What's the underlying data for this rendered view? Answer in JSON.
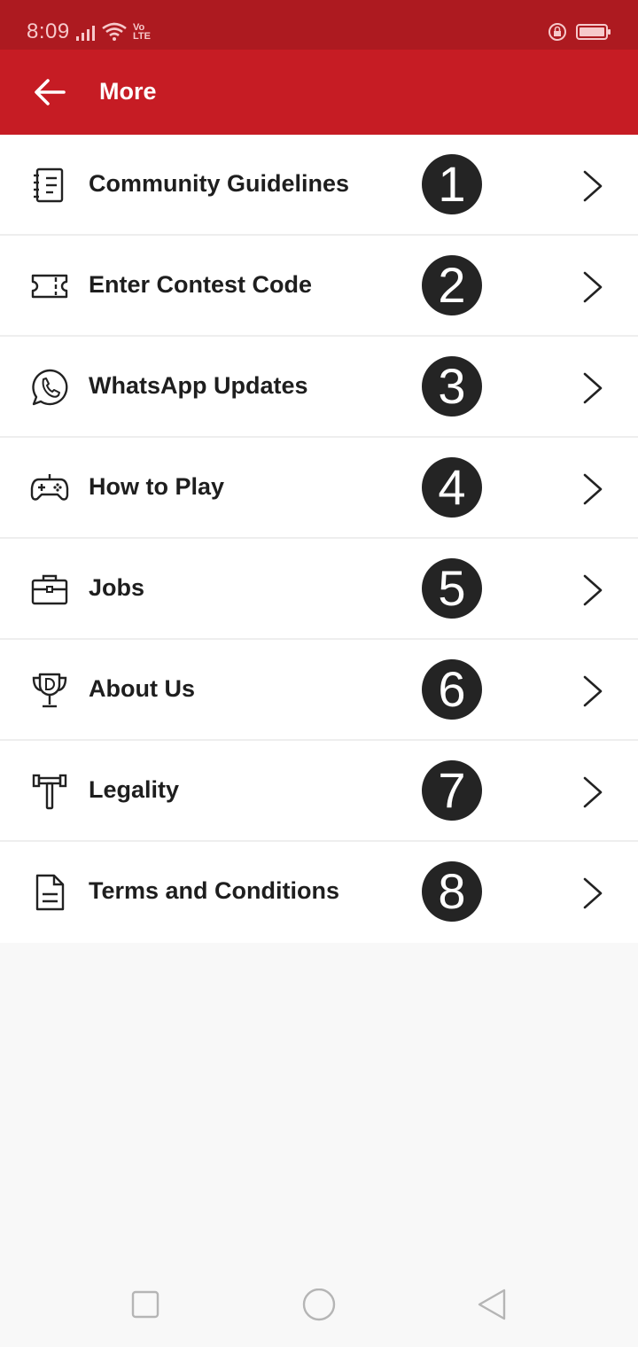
{
  "status_bar": {
    "time": "8:09",
    "network_label": "Vo\nLTE",
    "icons": [
      "signal-icon",
      "wifi-icon",
      "volte-icon",
      "rotation-lock-icon",
      "battery-icon"
    ],
    "color": "#ad1a20"
  },
  "app_bar": {
    "title": "More",
    "back_icon": "arrow-left-icon",
    "color": "#c61c24"
  },
  "menu": {
    "items": [
      {
        "label": "Community Guidelines",
        "icon": "notebook-icon",
        "badge": "1"
      },
      {
        "label": "Enter Contest Code",
        "icon": "ticket-icon",
        "badge": "2"
      },
      {
        "label": "WhatsApp Updates",
        "icon": "whatsapp-icon",
        "badge": "3"
      },
      {
        "label": "How to Play",
        "icon": "gamepad-icon",
        "badge": "4"
      },
      {
        "label": "Jobs",
        "icon": "briefcase-icon",
        "badge": "5"
      },
      {
        "label": "About Us",
        "icon": "trophy-icon",
        "badge": "6"
      },
      {
        "label": "Legality",
        "icon": "gavel-icon",
        "badge": "7"
      },
      {
        "label": "Terms and Conditions",
        "icon": "document-icon",
        "badge": "8"
      }
    ]
  },
  "nav_bar": {
    "buttons": [
      "recents-square-icon",
      "home-circle-icon",
      "back-triangle-icon"
    ]
  }
}
